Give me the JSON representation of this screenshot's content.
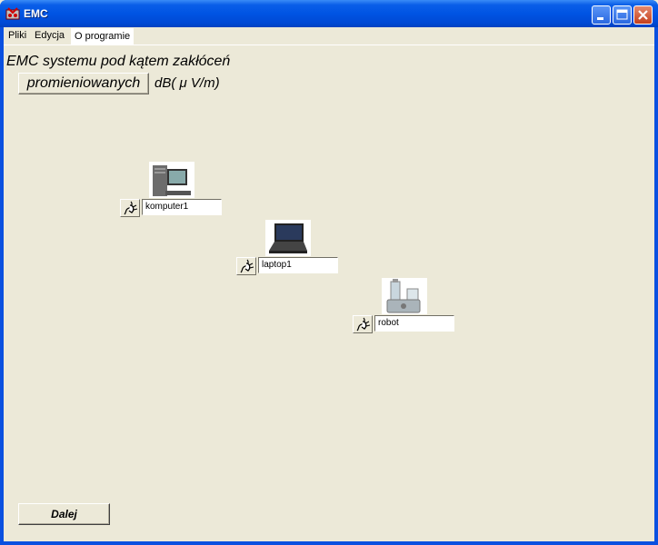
{
  "window": {
    "title": "EMC"
  },
  "menu": {
    "items": [
      "Pliki",
      "Edycja",
      "O programie"
    ]
  },
  "headline": "EMC systemu pod kątem zakłóceń",
  "type_button_label": "promieniowanych",
  "unit_label": "dB( μ V/m)",
  "devices": [
    {
      "name": "komputer1",
      "icon": "desktop-pc-icon"
    },
    {
      "name": "laptop1",
      "icon": "laptop-icon"
    },
    {
      "name": "robot",
      "icon": "food-processor-icon"
    }
  ],
  "next_button_label": "Dalej"
}
